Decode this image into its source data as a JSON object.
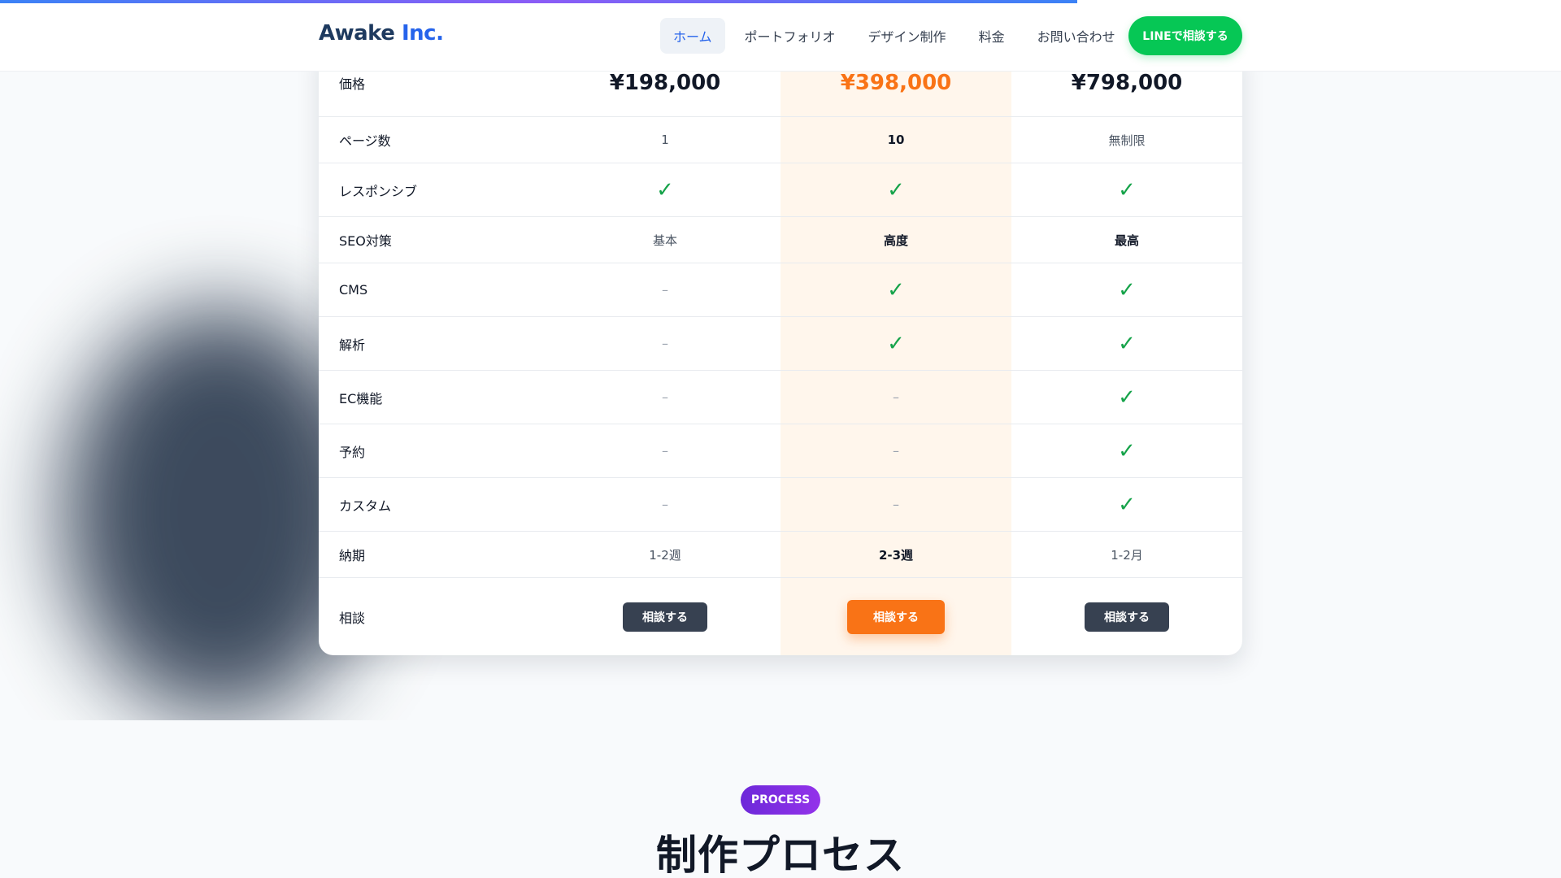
{
  "progress": {
    "fraction": 0.69
  },
  "header": {
    "brand_main": "Awake",
    "brand_accent": "Inc.",
    "nav": [
      {
        "label": "ホーム",
        "active": true
      },
      {
        "label": "ポートフォリオ"
      },
      {
        "label": "デザイン制作"
      },
      {
        "label": "料金"
      },
      {
        "label": "お問い合わせ"
      }
    ],
    "cta_label": "LINEで相談する"
  },
  "pricing": {
    "rows": [
      {
        "label": "価格",
        "values": [
          "¥198,000",
          "¥398,000",
          "¥798,000"
        ]
      },
      {
        "label": "ページ数",
        "values": [
          "1",
          "10",
          "無制限"
        ]
      },
      {
        "label": "レスポンシブ",
        "values": [
          "✓",
          "✓",
          "✓"
        ]
      },
      {
        "label": "SEO対策",
        "values": [
          "基本",
          "高度",
          "最高"
        ]
      },
      {
        "label": "CMS",
        "values": [
          "–",
          "✓",
          "✓"
        ]
      },
      {
        "label": "解析",
        "values": [
          "–",
          "✓",
          "✓"
        ]
      },
      {
        "label": "EC機能",
        "values": [
          "–",
          "–",
          "✓"
        ]
      },
      {
        "label": "予約",
        "values": [
          "–",
          "–",
          "✓"
        ]
      },
      {
        "label": "カスタム",
        "values": [
          "–",
          "–",
          "✓"
        ]
      },
      {
        "label": "納期",
        "values": [
          "1-2週",
          "2-3週",
          "1-2月"
        ]
      },
      {
        "label": "相談",
        "values": [
          "相談する",
          "相談する",
          "相談する"
        ]
      }
    ]
  },
  "process": {
    "badge": "PROCESS",
    "title": "制作プロセス"
  },
  "colors": {
    "accent_orange": "#f97316",
    "line_green": "#06c755",
    "check_green": "#16a34a",
    "highlight_bg": "#fff6ec"
  }
}
